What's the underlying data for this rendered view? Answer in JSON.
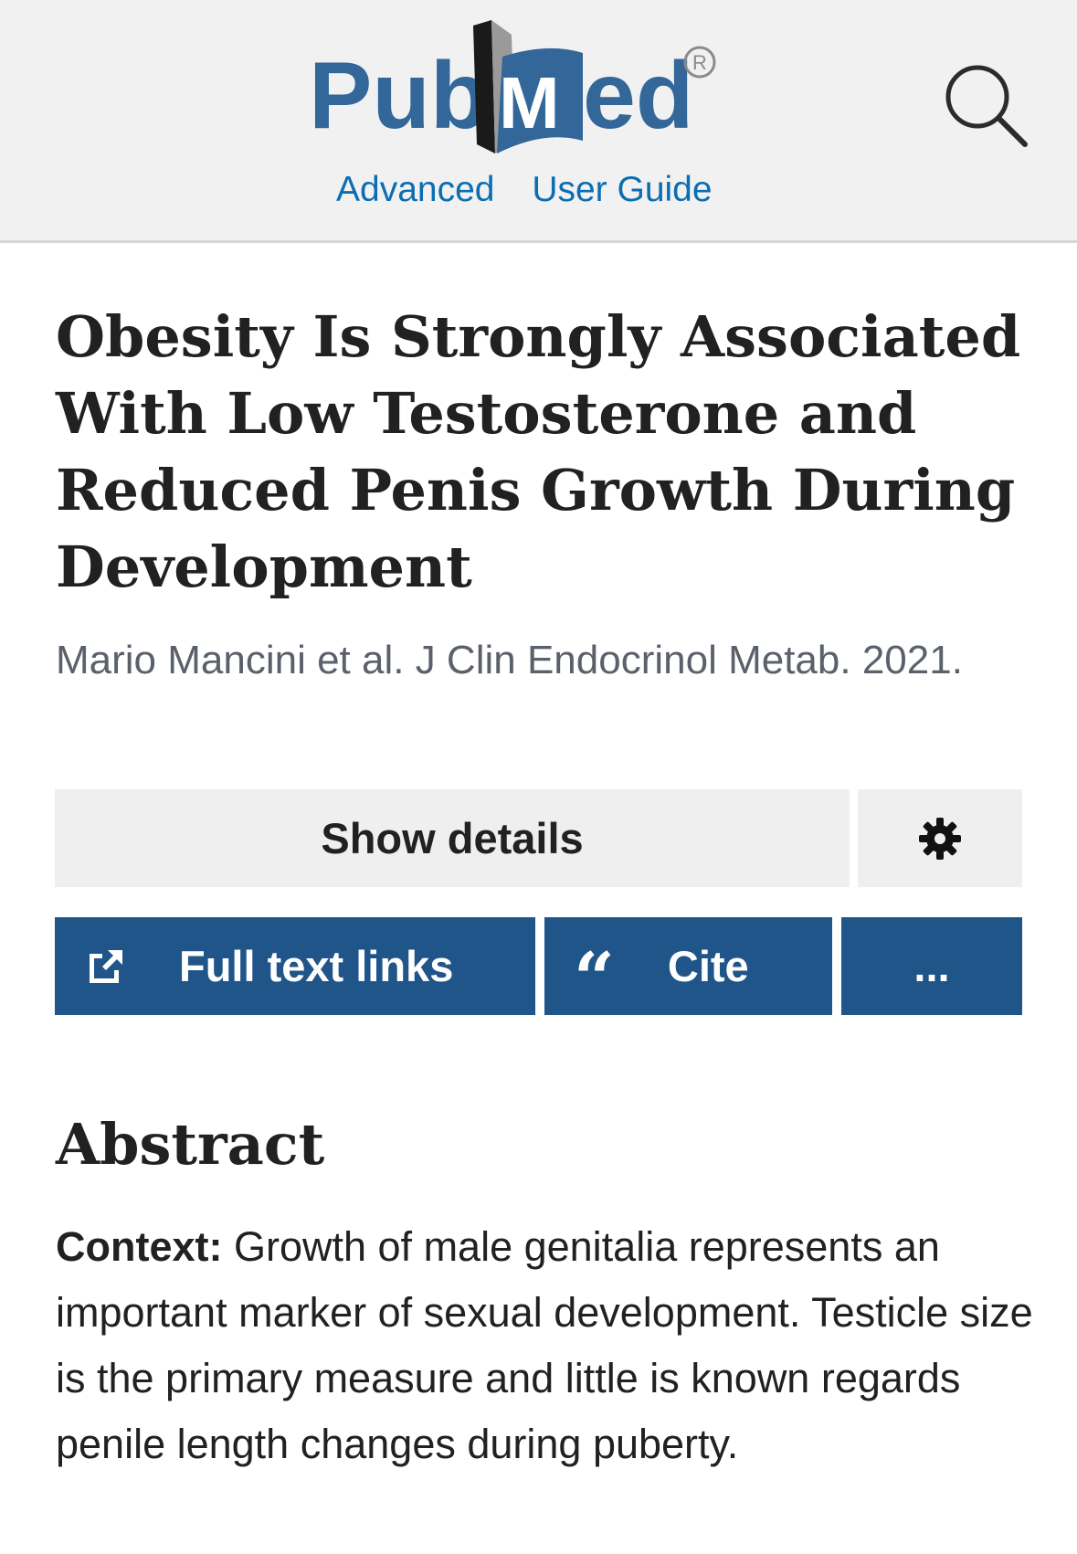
{
  "header": {
    "logo_text": "PubMed",
    "links": [
      {
        "label": "Advanced"
      },
      {
        "label": "User Guide"
      }
    ],
    "search_icon": "search-icon"
  },
  "article": {
    "title": "Obesity Is Strongly Associated With Low Testosterone and Reduced Penis Growth During Development",
    "citation": "Mario Mancini et al. J Clin Endocrinol Metab. 2021."
  },
  "actions": {
    "show_details": "Show details",
    "settings_icon": "gear-icon",
    "full_text": "Full text links",
    "full_text_icon": "external-link-icon",
    "cite": "Cite",
    "cite_icon": "quote-icon",
    "more": "...",
    "button_color": "#20558a"
  },
  "abstract": {
    "heading": "Abstract",
    "context_label": "Context:",
    "context_text": " Growth of male genitalia represents an important marker of sexual development. Testicle size is the primary measure and little is known regards penile length changes during puberty."
  },
  "colors": {
    "brand_blue": "#20558a",
    "link_blue": "#0b6db2",
    "header_bg": "#f1f1f1"
  }
}
